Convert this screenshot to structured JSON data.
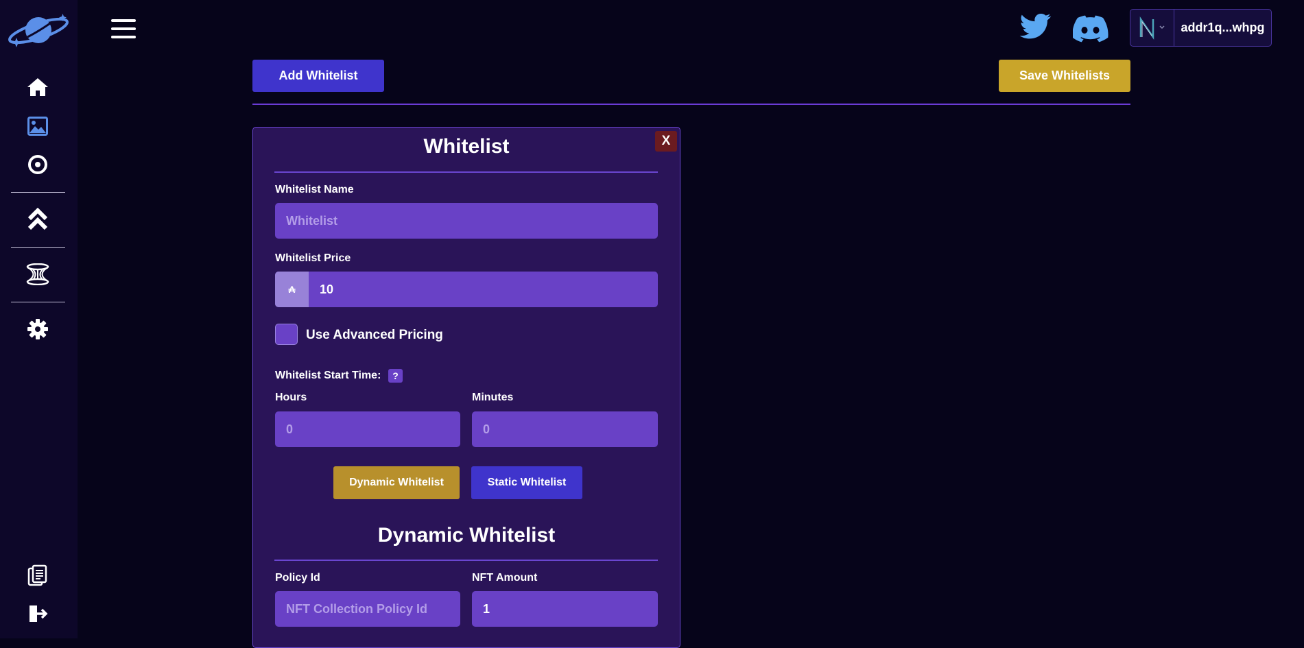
{
  "header": {
    "wallet_address": "addr1q...whpg"
  },
  "toolbar": {
    "add_label": "Add Whitelist",
    "save_label": "Save Whitelists"
  },
  "card": {
    "title": "Whitelist",
    "close_label": "X",
    "name_label": "Whitelist Name",
    "name_placeholder": "Whitelist",
    "price_label": "Whitelist Price",
    "currency_symbol": "₳",
    "price_value": "10",
    "advanced_label": "Use Advanced Pricing",
    "advanced_checked": false,
    "start_label": "Whitelist Start Time:",
    "help_label": "?",
    "hours_label": "Hours",
    "hours_placeholder": "0",
    "minutes_label": "Minutes",
    "minutes_placeholder": "0",
    "dynamic_btn": "Dynamic Whitelist",
    "static_btn": "Static Whitelist",
    "section_title": "Dynamic Whitelist",
    "policy_label": "Policy Id",
    "policy_placeholder": "NFT Collection Policy Id",
    "amount_label": "NFT Amount",
    "amount_value": "1"
  },
  "colors": {
    "background": "#06041a",
    "sidebar": "#0d0729",
    "primary": "#3f34cc",
    "accent": "#c9a52a",
    "card": "#2a1458",
    "input": "#6941c6",
    "danger": "#6b1b20"
  },
  "icons": {
    "sidebar": [
      "planet-logo-icon",
      "home-icon",
      "image-icon",
      "target-icon",
      "chevrons-up-icon",
      "hourglass-icon",
      "gear-icon",
      "document-icon",
      "logout-icon"
    ],
    "top": [
      "menu-icon",
      "twitter-icon",
      "discord-icon",
      "wallet-logo-icon",
      "chevron-down-icon"
    ]
  }
}
